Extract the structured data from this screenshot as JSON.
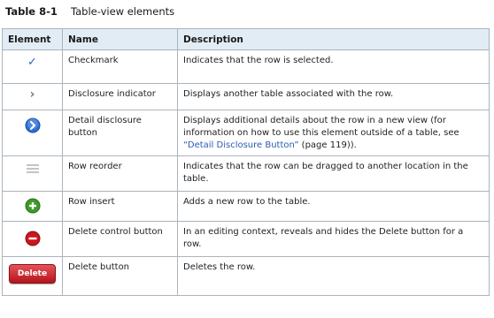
{
  "caption": {
    "number": "Table 8-1",
    "title": "Table-view elements"
  },
  "headers": {
    "element": "Element",
    "name": "Name",
    "description": "Description"
  },
  "rows": [
    {
      "icon": "checkmark-icon",
      "name": "Checkmark",
      "description": "Indicates that the row is selected."
    },
    {
      "icon": "disclosure-chevron-icon",
      "name": "Disclosure indicator",
      "description": "Displays another table associated with the row."
    },
    {
      "icon": "detail-disclosure-icon",
      "name": "Detail disclosure button",
      "description": "Displays additional details about the row in a new view (for information on how to use this element outside of a table, see",
      "link": "“Detail Disclosure Button”",
      "description_tail": " (page 119))."
    },
    {
      "icon": "reorder-grip-icon",
      "name": "Row reorder",
      "description": "Indicates that the row can be dragged to another location in the table."
    },
    {
      "icon": "row-insert-icon",
      "name": "Row insert",
      "description": "Adds a new row to the table."
    },
    {
      "icon": "delete-control-icon",
      "name": "Delete control button",
      "description": "In an editing context, reveals and hides the Delete button for a row."
    },
    {
      "icon": "delete-button-icon",
      "name": "Delete button",
      "description": "Deletes the row.",
      "button_label": "Delete"
    }
  ],
  "colors": {
    "header_bg": "#e2ecf5",
    "border": "#aab4bd",
    "link": "#2a5db0",
    "insert_green": "#3e9a2a",
    "delete_red": "#c8171e",
    "detail_blue": "#2b6fd6"
  }
}
